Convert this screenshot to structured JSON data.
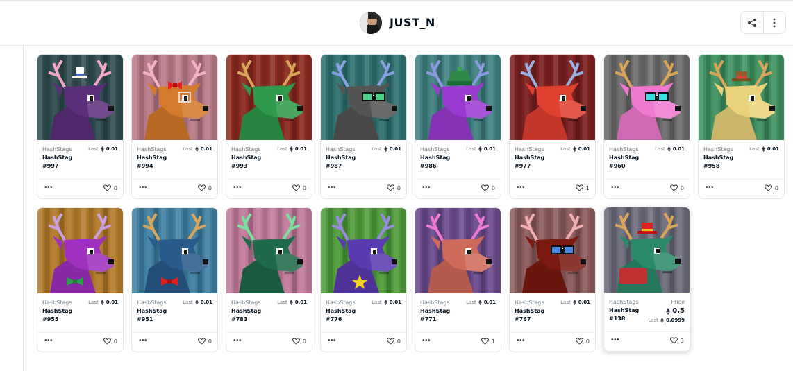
{
  "header": {
    "username": "JUST_N",
    "share_icon": "share-icon",
    "more_icon": "vertical-dots-icon"
  },
  "cards": [
    {
      "collection": "HashStags",
      "name": "HashStag",
      "number": "#997",
      "last_label": "Last",
      "last": "0.01",
      "likes": "0",
      "bg": "#2f4b4f",
      "fur": "#5a2f7a",
      "antler": "#f2a8c8",
      "acc": "hat-white"
    },
    {
      "collection": "HashStags",
      "name": "HashStag",
      "number": "#994",
      "last_label": "Last",
      "last": "0.01",
      "likes": "0",
      "bg": "#b57a86",
      "fur": "#d47a2a",
      "antler": "#f3b3c6",
      "acc": "bow-red"
    },
    {
      "collection": "HashStags",
      "name": "HashStag",
      "number": "#993",
      "last_label": "Last",
      "last": "0.01",
      "likes": "0",
      "bg": "#8a2a1e",
      "fur": "#2f9a4a",
      "antler": "#d9a55a",
      "acc": "none"
    },
    {
      "collection": "HashStags",
      "name": "HashStag",
      "number": "#987",
      "last_label": "Last",
      "last": "0.01",
      "likes": "0",
      "bg": "#2f6f6f",
      "fur": "#545454",
      "antler": "#8aa0e0",
      "acc": "glasses-green"
    },
    {
      "collection": "HashStags",
      "name": "HashStag",
      "number": "#986",
      "last_label": "Last",
      "last": "0.01",
      "likes": "0",
      "bg": "#3f7f7f",
      "fur": "#9a3ad0",
      "antler": "#8c9ae0",
      "acc": "beanie-green"
    },
    {
      "collection": "HashStags",
      "name": "HashStag",
      "number": "#977",
      "last_label": "Last",
      "last": "0.01",
      "likes": "1",
      "bg": "#7a1f1f",
      "fur": "#e04030",
      "antler": "#9ab0e0",
      "acc": "none"
    },
    {
      "collection": "HashStags",
      "name": "HashStag",
      "number": "#960",
      "last_label": "Last",
      "last": "0.01",
      "likes": "0",
      "bg": "#6a6a6a",
      "fur": "#ef7ad0",
      "antler": "#d9a55a",
      "acc": "glasses-cyan"
    },
    {
      "collection": "HashStags",
      "name": "HashStag",
      "number": "#958",
      "last_label": "Last",
      "last": "0.01",
      "likes": "0",
      "bg": "#3f8f5f",
      "fur": "#e9d27a",
      "antler": "#d9a55a",
      "acc": "hat-brown"
    },
    {
      "collection": "HashStags",
      "name": "HashStag",
      "number": "#955",
      "last_label": "Last",
      "last": "0.01",
      "likes": "0",
      "bg": "#b07a2a",
      "fur": "#a030c0",
      "antler": "#c9a0e0",
      "acc": "bowtie-green"
    },
    {
      "collection": "HashStags",
      "name": "HashStag",
      "number": "#951",
      "last_label": "Last",
      "last": "0.01",
      "likes": "0",
      "bg": "#3f7f9f",
      "fur": "#2a5a8a",
      "antler": "#d9a55a",
      "acc": "bowtie-red"
    },
    {
      "collection": "HashStags",
      "name": "HashStag",
      "number": "#783",
      "last_label": "Last",
      "last": "0.01",
      "likes": "0",
      "bg": "#c07a9a",
      "fur": "#1f6a4a",
      "antler": "#7ae0a0",
      "acc": "none"
    },
    {
      "collection": "HashStags",
      "name": "HashStag",
      "number": "#776",
      "last_label": "Last",
      "last": "0.01",
      "likes": "0",
      "bg": "#4f9a3a",
      "fur": "#5a3ab0",
      "antler": "#9a8ae0",
      "acc": "star"
    },
    {
      "collection": "HashStags",
      "name": "HashStag",
      "number": "#771",
      "last_label": "Last",
      "last": "0.01",
      "likes": "1",
      "bg": "#6a4a8a",
      "fur": "#d06a5a",
      "antler": "#f07ad0",
      "acc": "none"
    },
    {
      "collection": "HashStags",
      "name": "HashStag",
      "number": "#767",
      "last_label": "Last",
      "last": "0.01",
      "likes": "0",
      "bg": "#8a5a5a",
      "fur": "#7a1a10",
      "antler": "#f0b0b0",
      "acc": "glasses-blue"
    }
  ],
  "featured": {
    "collection": "HashStags",
    "name": "HashStag",
    "number": "#138",
    "price_label": "Price",
    "price": "0.5",
    "last_label": "Last",
    "last": "0.0999",
    "likes": "3",
    "bg": "#6a6a7a",
    "fur": "#2a8a6a",
    "antler": "#d9a55a",
    "acc": "hat-red"
  }
}
